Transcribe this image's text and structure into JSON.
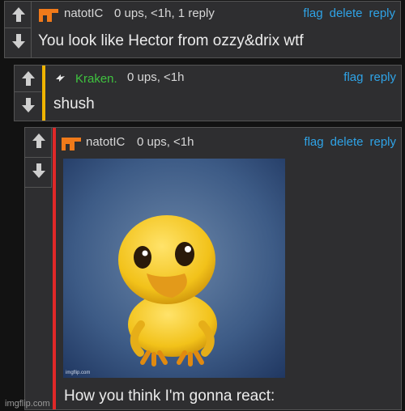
{
  "comments": [
    {
      "username": "natotIC",
      "meta": "0 ups, <1h, 1 reply",
      "actions": [
        "flag",
        "delete",
        "reply"
      ],
      "text": "You look like Hector from ozzy&drix wtf"
    },
    {
      "username": "Kraken.",
      "meta": "0 ups, <1h",
      "actions": [
        "flag",
        "reply"
      ],
      "text": "shush"
    },
    {
      "username": "natotIC",
      "meta": "0 ups, <1h",
      "actions": [
        "flag",
        "delete",
        "reply"
      ],
      "image_watermark": "imgflip.com",
      "caption": "How you think I'm gonna react:"
    }
  ],
  "footer": "imgflip.com",
  "colors": {
    "reply_bar_1": "#f0b400",
    "reply_bar_2": "#e02828",
    "link_blue": "#2fa3e6",
    "kraken_green": "#3fc23f"
  }
}
